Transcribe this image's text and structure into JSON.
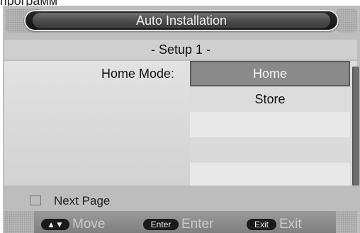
{
  "top_fragment": "программ",
  "window": {
    "title": "Auto Installation"
  },
  "setup_title": "- Setup 1 -",
  "field": {
    "label": "Home Mode:",
    "options": [
      "Home",
      "Store"
    ],
    "selected": "Home"
  },
  "footer": {
    "next_page_label": "Next Page",
    "keys": [
      {
        "key": "▲▼",
        "action": "Move"
      },
      {
        "key": "Enter",
        "action": "Enter"
      },
      {
        "key": "Exit",
        "action": "Exit"
      }
    ]
  },
  "colors": {
    "title_bar": "#1a1a1a",
    "selected_option": "#8a8a8a",
    "background": "#bdbdbd"
  }
}
